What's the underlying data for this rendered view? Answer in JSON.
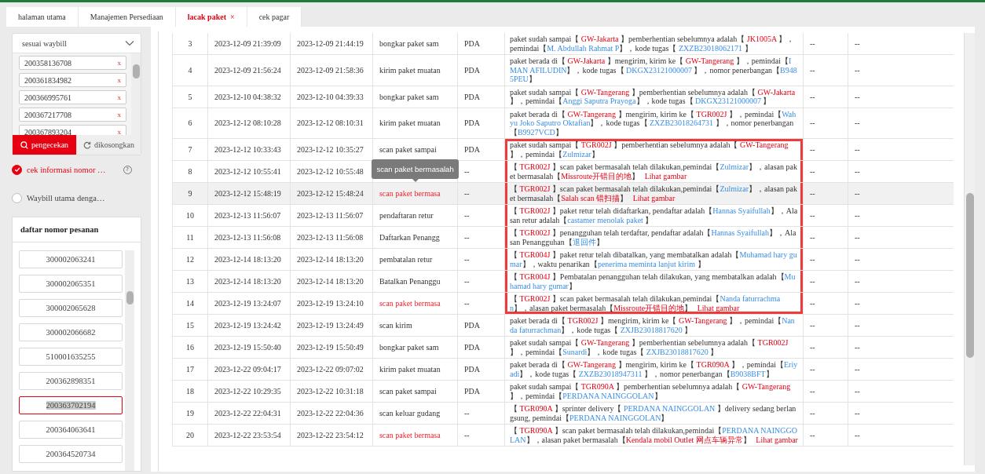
{
  "tabs": [
    {
      "label": "halaman utama",
      "selected": false
    },
    {
      "label": "Manajemen Persediaan",
      "selected": false
    },
    {
      "label": "lacak paket",
      "selected": true,
      "close": "×"
    },
    {
      "label": "cek pagar",
      "selected": false
    }
  ],
  "filter": {
    "mode": "sesuai waybill",
    "waybills": [
      {
        "number": "200358136708",
        "remove": "x"
      },
      {
        "number": "200361834982",
        "remove": "x"
      },
      {
        "number": "200366995761",
        "remove": "x"
      },
      {
        "number": "200367217708",
        "remove": "x"
      },
      {
        "number": "200367893204",
        "remove": "x"
      }
    ],
    "buttons": [
      {
        "label": "pengecekan",
        "kind": "primary"
      },
      {
        "label": "dikosongkan",
        "kind": "secondary"
      }
    ]
  },
  "options": [
    {
      "label": "cek informasi nomor …",
      "selected": true,
      "help": "?"
    },
    {
      "label": "Waybill utama denga…",
      "selected": false
    }
  ],
  "order_list": {
    "title": "daftar nomor pesanan",
    "items": [
      {
        "number": "300002063241",
        "selected": false
      },
      {
        "number": "300002065351",
        "selected": false
      },
      {
        "number": "300002065628",
        "selected": false
      },
      {
        "number": "300002066682",
        "selected": false
      },
      {
        "number": "510001635255",
        "selected": false
      },
      {
        "number": "200362898351",
        "selected": false
      },
      {
        "number": "200363702194",
        "selected": true
      },
      {
        "number": "200364063641",
        "selected": false
      },
      {
        "number": "200364520734",
        "selected": false
      }
    ]
  },
  "table": {
    "rows": [
      {
        "no": "3",
        "start": "2023-12-09 21:39:09",
        "end": "2023-12-09 21:44:19",
        "event": "bongkar paket sam",
        "alert": false,
        "source": "PDA",
        "selected": false,
        "in_frame": false,
        "column_7": "--",
        "column_8": "--",
        "detail": [
          {
            "kind": "text",
            "text": "paket sudah sampai【 "
          },
          {
            "kind": "place",
            "text": "GW-Jakarta"
          },
          {
            "kind": "text",
            "text": " 】pemberhentian sebelumnya adalah【 "
          },
          {
            "kind": "place",
            "text": "JK1005A"
          },
          {
            "kind": "text",
            "text": " 】，pemindai【"
          },
          {
            "kind": "info",
            "text": "M. Abdullah Rahmat P"
          },
          {
            "kind": "text",
            "text": "】，kode tugas【 "
          },
          {
            "kind": "info",
            "text": "ZXZB23018062171"
          },
          {
            "kind": "text",
            "text": " 】"
          }
        ]
      },
      {
        "no": "4",
        "start": "2023-12-09 21:56:24",
        "end": "2023-12-09 21:58:36",
        "event": "kirim paket muatan",
        "alert": false,
        "source": "PDA",
        "selected": false,
        "in_frame": false,
        "column_7": "--",
        "column_8": "--",
        "detail": [
          {
            "kind": "text",
            "text": "paket berada di【 "
          },
          {
            "kind": "place",
            "text": "GW-Jakarta"
          },
          {
            "kind": "text",
            "text": " 】mengirim, kirim ke【 "
          },
          {
            "kind": "place",
            "text": "GW-Tangerang"
          },
          {
            "kind": "text",
            "text": " 】，pemindai【"
          },
          {
            "kind": "info",
            "text": "IMAN AFILUDIN"
          },
          {
            "kind": "text",
            "text": "】，kode tugas【 "
          },
          {
            "kind": "info",
            "text": "DKGX23121000007"
          },
          {
            "kind": "text",
            "text": " 】，nomor penerbangan【"
          },
          {
            "kind": "info",
            "text": "B9485PEU"
          },
          {
            "kind": "text",
            "text": "】"
          }
        ]
      },
      {
        "no": "5",
        "start": "2023-12-10 04:38:32",
        "end": "2023-12-10 04:39:33",
        "event": "bongkar paket sam",
        "alert": false,
        "source": "PDA",
        "selected": false,
        "in_frame": false,
        "column_7": "--",
        "column_8": "--",
        "detail": [
          {
            "kind": "text",
            "text": "paket sudah sampai【 "
          },
          {
            "kind": "place",
            "text": "GW-Tangerang"
          },
          {
            "kind": "text",
            "text": " 】pemberhentian sebelumnya adalah【 "
          },
          {
            "kind": "place",
            "text": "GW-Jakarta"
          },
          {
            "kind": "text",
            "text": " 】，pemindai【"
          },
          {
            "kind": "info",
            "text": "Anggi Saputra Prayoga"
          },
          {
            "kind": "text",
            "text": "】，kode tugas【 "
          },
          {
            "kind": "info",
            "text": "DKGX23121000007"
          },
          {
            "kind": "text",
            "text": " 】"
          }
        ]
      },
      {
        "no": "6",
        "start": "2023-12-12 08:10:28",
        "end": "2023-12-12 08:10:31",
        "event": "kirim paket muatan",
        "alert": false,
        "source": "PDA",
        "selected": false,
        "in_frame": false,
        "column_7": "--",
        "column_8": "--",
        "detail": [
          {
            "kind": "text",
            "text": "paket berada di【 "
          },
          {
            "kind": "place",
            "text": "GW-Tangerang"
          },
          {
            "kind": "text",
            "text": " 】mengirim, kirim ke【 "
          },
          {
            "kind": "place",
            "text": "TGR002J"
          },
          {
            "kind": "text",
            "text": " 】，pemindai【"
          },
          {
            "kind": "info",
            "text": "Wahyu Joko Saputro Oktafian"
          },
          {
            "kind": "text",
            "text": "】，kode tugas【 "
          },
          {
            "kind": "info",
            "text": "ZXZB23018264731"
          },
          {
            "kind": "text",
            "text": " 】，nomor penerbangan【"
          },
          {
            "kind": "info",
            "text": "B9927VCD"
          },
          {
            "kind": "text",
            "text": "】"
          }
        ]
      },
      {
        "no": "7",
        "start": "2023-12-12 10:33:43",
        "end": "2023-12-12 10:35:27",
        "event": "scan paket sampai",
        "alert": false,
        "source": "PDA",
        "selected": false,
        "in_frame": true,
        "column_7": "--",
        "column_8": "--",
        "detail": [
          {
            "kind": "text",
            "text": "paket sudah sampai【 "
          },
          {
            "kind": "place",
            "text": "TGR002J"
          },
          {
            "kind": "text",
            "text": " 】pemberhentian sebelumnya adalah【 "
          },
          {
            "kind": "place",
            "text": "GW-Tangerang"
          },
          {
            "kind": "text",
            "text": " 】，pemindai【"
          },
          {
            "kind": "info",
            "text": "Zulmizar"
          },
          {
            "kind": "text",
            "text": "】"
          }
        ]
      },
      {
        "no": "8",
        "start": "2023-12-12 10:55:41",
        "end": "2023-12-12 10:55:48",
        "source": "--",
        "selected": false,
        "in_frame": true,
        "column_7": "--",
        "column_8": "--",
        "detail": [
          {
            "kind": "text",
            "text": "【 "
          },
          {
            "kind": "place",
            "text": "TGR002J"
          },
          {
            "kind": "text",
            "text": " 】scan paket bermasalah telah dilakukan,pemindai【"
          },
          {
            "kind": "info",
            "text": "Zulmizar"
          },
          {
            "kind": "text",
            "text": "】，alasan paket bermasalah【"
          },
          {
            "kind": "place",
            "text": "Missroute开错目的地"
          },
          {
            "kind": "text",
            "text": "】 "
          },
          {
            "kind": "link",
            "text": "Lihat gambar"
          }
        ]
      },
      {
        "no": "9",
        "start": "2023-12-12 15:48:19",
        "end": "2023-12-12 15:48:24",
        "event": "scan paket bermasa",
        "tooltip": "scan paket bermasalah",
        "alert": true,
        "source": "--",
        "selected": true,
        "in_frame": true,
        "column_7": "--",
        "column_8": "--",
        "detail": [
          {
            "kind": "text",
            "text": "【 "
          },
          {
            "kind": "place",
            "text": "TGR002J"
          },
          {
            "kind": "text",
            "text": " 】scan paket bermasalah telah dilakukan,pemindai【"
          },
          {
            "kind": "info",
            "text": "Zulmizar"
          },
          {
            "kind": "text",
            "text": "】，alasan paket bermasalah【"
          },
          {
            "kind": "place",
            "text": "Salah scan 错扫描"
          },
          {
            "kind": "text",
            "text": "】 "
          },
          {
            "kind": "link",
            "text": "Lihat gambar"
          }
        ]
      },
      {
        "no": "10",
        "start": "2023-12-13 11:56:07",
        "end": "2023-12-13 11:56:07",
        "event": "pendaftaran retur",
        "alert": false,
        "source": "--",
        "selected": false,
        "in_frame": true,
        "column_7": "--",
        "column_8": "--",
        "detail": [
          {
            "kind": "text",
            "text": "【 "
          },
          {
            "kind": "place",
            "text": "TGR002J"
          },
          {
            "kind": "text",
            "text": " 】paket retur telah didaftarkan, pendaftar adalah【"
          },
          {
            "kind": "info",
            "text": "Hannas Syaifullah"
          },
          {
            "kind": "text",
            "text": "】，Alasan retur adalah【"
          },
          {
            "kind": "info",
            "text": "castamer menolak paket"
          },
          {
            "kind": "text",
            "text": " 】"
          }
        ]
      },
      {
        "no": "11",
        "start": "2023-12-13 11:56:08",
        "end": "2023-12-13 11:56:08",
        "event": "Daftarkan Penangg",
        "alert": false,
        "source": "--",
        "selected": false,
        "in_frame": true,
        "column_7": "--",
        "column_8": "--",
        "detail": [
          {
            "kind": "text",
            "text": "【 "
          },
          {
            "kind": "place",
            "text": "TGR002J"
          },
          {
            "kind": "text",
            "text": " 】penangguhan telah terdaftar, pendaftar adalah【"
          },
          {
            "kind": "info",
            "text": "Hannas Syaifullah"
          },
          {
            "kind": "text",
            "text": "】，Alasan Penangguhan【"
          },
          {
            "kind": "info",
            "text": "退回件"
          },
          {
            "kind": "text",
            "text": "】"
          }
        ]
      },
      {
        "no": "12",
        "start": "2023-12-14 18:13:20",
        "end": "2023-12-14 18:13:20",
        "event": "pembatalan retur",
        "alert": false,
        "source": "--",
        "selected": false,
        "in_frame": true,
        "column_7": "--",
        "column_8": "--",
        "detail": [
          {
            "kind": "text",
            "text": "【 "
          },
          {
            "kind": "place",
            "text": "TGR004J"
          },
          {
            "kind": "text",
            "text": " 】paket retur telah dibatalkan, yang membatalkan adalah【"
          },
          {
            "kind": "info",
            "text": "Muhamad hary gumar"
          },
          {
            "kind": "text",
            "text": "】，waktu penarikan【"
          },
          {
            "kind": "info",
            "text": "penerima meminta lanjut kirim"
          },
          {
            "kind": "text",
            "text": " 】"
          }
        ]
      },
      {
        "no": "13",
        "start": "2023-12-14 18:13:20",
        "end": "2023-12-14 18:13:20",
        "event": "Batalkan Penanggu",
        "alert": false,
        "source": "--",
        "selected": false,
        "in_frame": true,
        "column_7": "--",
        "column_8": "--",
        "detail": [
          {
            "kind": "text",
            "text": "【 "
          },
          {
            "kind": "place",
            "text": "TGR004J"
          },
          {
            "kind": "text",
            "text": " 】Pembatalan penangguhan telah dilakukan, yang membatalkan adalah【"
          },
          {
            "kind": "info",
            "text": "Muhamad hary gumar"
          },
          {
            "kind": "text",
            "text": "】"
          }
        ]
      },
      {
        "no": "14",
        "start": "2023-12-19 13:24:07",
        "end": "2023-12-19 13:24:10",
        "event": "scan paket bermasa",
        "alert": true,
        "source": "--",
        "selected": false,
        "in_frame": true,
        "column_7": "--",
        "column_8": "--",
        "detail": [
          {
            "kind": "text",
            "text": "【 "
          },
          {
            "kind": "place",
            "text": "TGR002J"
          },
          {
            "kind": "text",
            "text": " 】scan paket bermasalah telah dilakukan,pemindai【"
          },
          {
            "kind": "info",
            "text": "Nanda faturrachman"
          },
          {
            "kind": "text",
            "text": "】，alasan paket bermasalah【"
          },
          {
            "kind": "place",
            "text": "Missroute开错目的地"
          },
          {
            "kind": "text",
            "text": "】 "
          },
          {
            "kind": "link",
            "text": "Lihat gambar"
          }
        ]
      },
      {
        "no": "15",
        "start": "2023-12-19 13:24:42",
        "end": "2023-12-19 13:24:49",
        "event": "scan kirim",
        "alert": false,
        "source": "PDA",
        "selected": false,
        "in_frame": false,
        "column_7": "--",
        "column_8": "--",
        "detail": [
          {
            "kind": "text",
            "text": "paket berada di【 "
          },
          {
            "kind": "place",
            "text": "TGR002J"
          },
          {
            "kind": "text",
            "text": " 】mengirim, kirim ke【 "
          },
          {
            "kind": "place",
            "text": "GW-Tangerang"
          },
          {
            "kind": "text",
            "text": " 】，pemindai【"
          },
          {
            "kind": "info",
            "text": "Nanda faturrachman"
          },
          {
            "kind": "text",
            "text": "】，kode tugas【 "
          },
          {
            "kind": "info",
            "text": "ZXJB23018817620"
          },
          {
            "kind": "text",
            "text": " 】"
          }
        ]
      },
      {
        "no": "16",
        "start": "2023-12-19 15:50:40",
        "end": "2023-12-19 15:50:49",
        "event": "bongkar paket sam",
        "alert": false,
        "source": "PDA",
        "selected": false,
        "in_frame": false,
        "column_7": "--",
        "column_8": "--",
        "detail": [
          {
            "kind": "text",
            "text": "paket sudah sampai【 "
          },
          {
            "kind": "place",
            "text": "GW-Tangerang"
          },
          {
            "kind": "text",
            "text": " 】pemberhentian sebelumnya adalah【 "
          },
          {
            "kind": "place",
            "text": "TGR002J"
          },
          {
            "kind": "text",
            "text": " 】，pemindai【"
          },
          {
            "kind": "info",
            "text": "Sunardi"
          },
          {
            "kind": "text",
            "text": "】，kode tugas【 "
          },
          {
            "kind": "info",
            "text": "ZXJB23018817620"
          },
          {
            "kind": "text",
            "text": " 】"
          }
        ]
      },
      {
        "no": "17",
        "start": "2023-12-22 09:04:17",
        "end": "2023-12-22 09:07:02",
        "event": "kirim paket muatan",
        "alert": false,
        "source": "PDA",
        "selected": false,
        "in_frame": false,
        "column_7": "--",
        "column_8": "--",
        "detail": [
          {
            "kind": "text",
            "text": "paket berada di【 "
          },
          {
            "kind": "place",
            "text": "GW-Tangerang"
          },
          {
            "kind": "text",
            "text": " 】mengirim, kirim ke【 "
          },
          {
            "kind": "place",
            "text": "TGR090A"
          },
          {
            "kind": "text",
            "text": " 】，pemindai【"
          },
          {
            "kind": "info",
            "text": "Eriyadi"
          },
          {
            "kind": "text",
            "text": "】，kode tugas【 "
          },
          {
            "kind": "info",
            "text": "ZXZB23018947311"
          },
          {
            "kind": "text",
            "text": " 】，nomor penerbangan【"
          },
          {
            "kind": "info",
            "text": "B9038BFT"
          },
          {
            "kind": "text",
            "text": "】"
          }
        ]
      },
      {
        "no": "18",
        "start": "2023-12-22 10:29:35",
        "end": "2023-12-22 10:31:18",
        "event": "scan paket sampai",
        "alert": false,
        "source": "PDA",
        "selected": false,
        "in_frame": false,
        "column_7": "--",
        "column_8": "--",
        "detail": [
          {
            "kind": "text",
            "text": "paket sudah sampai【 "
          },
          {
            "kind": "place",
            "text": "TGR090A"
          },
          {
            "kind": "text",
            "text": " 】pemberhentian sebelumnya adalah【 "
          },
          {
            "kind": "place",
            "text": "GW-Tangerang"
          },
          {
            "kind": "text",
            "text": " 】，pemindai【"
          },
          {
            "kind": "info",
            "text": "PERDANA NAINGGOLAN"
          },
          {
            "kind": "text",
            "text": "】"
          }
        ]
      },
      {
        "no": "19",
        "start": "2023-12-22 22:04:31",
        "end": "2023-12-22 22:04:36",
        "event": "scan keluar gudang",
        "alert": false,
        "source": "--",
        "selected": false,
        "in_frame": false,
        "column_7": "--",
        "column_8": "--",
        "detail": [
          {
            "kind": "text",
            "text": "【 "
          },
          {
            "kind": "place",
            "text": "TGR090A"
          },
          {
            "kind": "text",
            "text": " 】sprinter delivery【 "
          },
          {
            "kind": "info",
            "text": "PERDANA NAINGGOLAN"
          },
          {
            "kind": "text",
            "text": " 】delivery sedang berlangsung, pemindai【"
          },
          {
            "kind": "info",
            "text": "PERDANA NAINGGOLAN"
          },
          {
            "kind": "text",
            "text": "】"
          }
        ]
      },
      {
        "no": "20",
        "start": "2023-12-22 23:53:54",
        "end": "2023-12-22 23:54:12",
        "event": "scan paket bermasa",
        "alert": true,
        "source": "--",
        "selected": false,
        "in_frame": false,
        "column_7": "--",
        "column_8": "--",
        "detail": [
          {
            "kind": "text",
            "text": "【 "
          },
          {
            "kind": "place",
            "text": "TGR090A"
          },
          {
            "kind": "text",
            "text": " 】scan paket bermasalah telah dilakukan,pemindai【"
          },
          {
            "kind": "info",
            "text": "PERDANA NAINGGOLAN"
          },
          {
            "kind": "text",
            "text": "】，alasan paket bermasalah【"
          },
          {
            "kind": "place",
            "text": "Kendala mobil Outlet 网点车辆异常"
          },
          {
            "kind": "text",
            "text": "】 "
          },
          {
            "kind": "link",
            "text": "Lihat gambar"
          }
        ]
      }
    ]
  }
}
